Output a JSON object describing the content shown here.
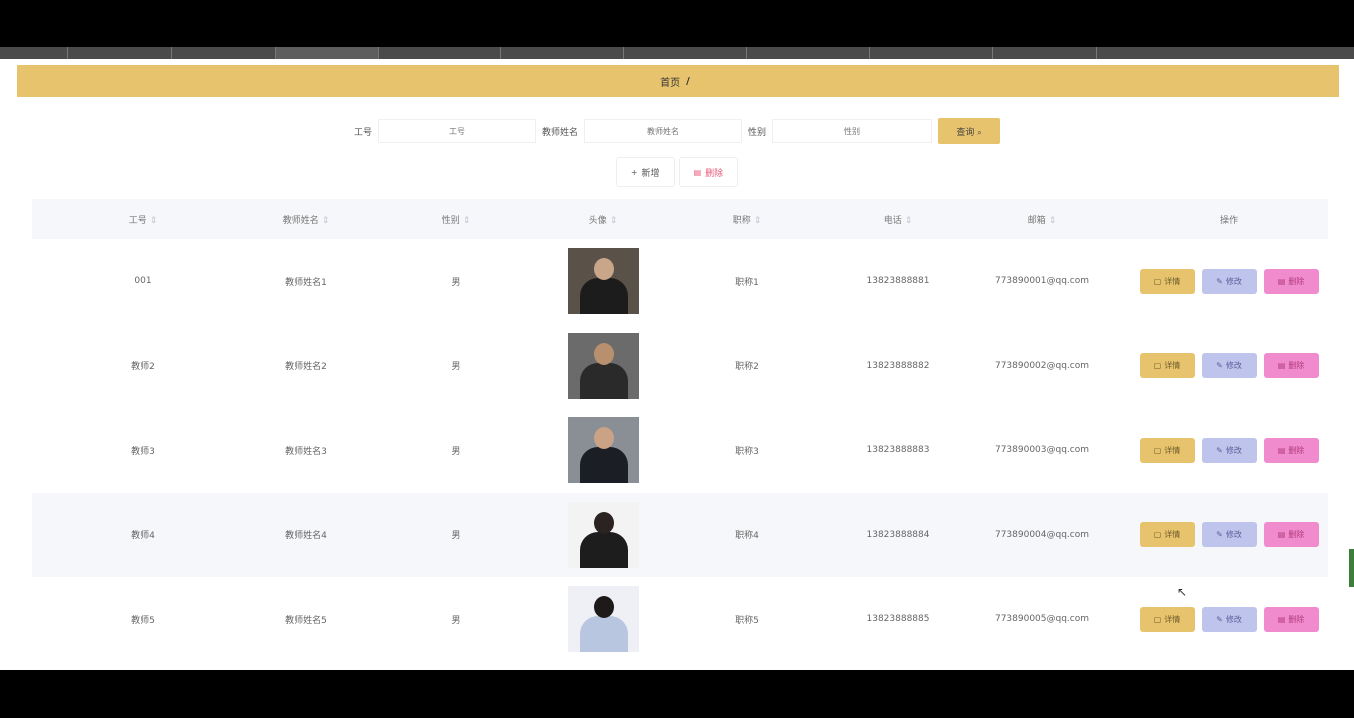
{
  "breadcrumb": {
    "home": "首页",
    "separator": "/",
    "current": ""
  },
  "search": {
    "fields": [
      {
        "label": "工号",
        "placeholder": "工号"
      },
      {
        "label": "教师姓名",
        "placeholder": "教师姓名"
      },
      {
        "label": "性别",
        "placeholder": "性别"
      }
    ],
    "query_label": "查询"
  },
  "toolbar": {
    "add_label": "新增",
    "delete_label": "删除"
  },
  "table": {
    "columns": [
      "工号",
      "教师姓名",
      "性别",
      "头像",
      "职称",
      "电话",
      "邮箱",
      "操作"
    ],
    "rows": [
      {
        "id": "001",
        "name": "教师姓名1",
        "gender": "男",
        "title": "职称1",
        "phone": "13823888881",
        "email": "773890001@qq.com"
      },
      {
        "id": "教师2",
        "name": "教师姓名2",
        "gender": "男",
        "title": "职称2",
        "phone": "13823888882",
        "email": "773890002@qq.com"
      },
      {
        "id": "教师3",
        "name": "教师姓名3",
        "gender": "男",
        "title": "职称3",
        "phone": "13823888883",
        "email": "773890003@qq.com"
      },
      {
        "id": "教师4",
        "name": "教师姓名4",
        "gender": "男",
        "title": "职称4",
        "phone": "13823888884",
        "email": "773890004@qq.com"
      },
      {
        "id": "教师5",
        "name": "教师姓名5",
        "gender": "男",
        "title": "职称5",
        "phone": "13823888885",
        "email": "773890005@qq.com"
      }
    ],
    "op_labels": {
      "detail": "详情",
      "edit": "修改",
      "remove": "删除"
    }
  },
  "colors": {
    "accent": "#e8c36d",
    "edit": "#bfc4ec",
    "remove": "#f08bcd",
    "header_bg": "#f5f7fa"
  }
}
